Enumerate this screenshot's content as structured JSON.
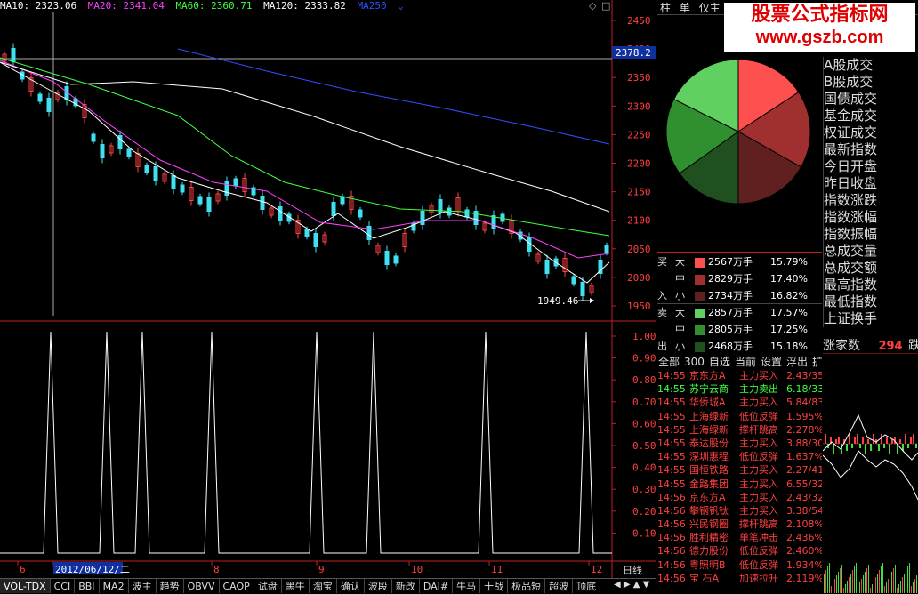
{
  "ma_bar": {
    "ma10": "MA10: 2323.06",
    "ma20": "MA20: 2341.04",
    "ma60": "MA60: 2360.71",
    "ma120": "MA120: 2333.82",
    "ma250": "MA250"
  },
  "colors": {
    "ma10": "#ffffff",
    "ma20": "#ff40ff",
    "ma60": "#40ff40",
    "ma120": "#ffffff",
    "ma250": "#3050ff",
    "up": "#ff4040",
    "down": "#40e0f0",
    "axis": "#c02020",
    "label": "#ff4040"
  },
  "price_axis": {
    "ticks": [
      "2450",
      "2400",
      "2350",
      "2300",
      "2250",
      "2200",
      "2150",
      "2100",
      "2050",
      "2000",
      "1950"
    ],
    "current_price": "2378.2",
    "low_marker": "1949.46"
  },
  "indicator_axis": {
    "ticks": [
      "1.00",
      "0.90",
      "0.80",
      "0.70",
      "0.60",
      "0.50",
      "0.40",
      "0.30",
      "0.20",
      "0.10"
    ]
  },
  "date_axis": {
    "labels": [
      "6",
      "2012/06/12/二",
      "8",
      "9",
      "10",
      "11",
      "12"
    ],
    "period": "日线"
  },
  "bottom_tabs": [
    "VOL-TDX",
    "CCI",
    "BBI",
    "MA2",
    "波主",
    "趋势",
    "OBVV",
    "CAOP",
    "试盘",
    "黑牛",
    "淘宝",
    "确认",
    "波段",
    "新改",
    "DAI#",
    "牛马",
    "十战",
    "极品短",
    "超波",
    "顶底"
  ],
  "right_tabs": [
    "柱",
    "单",
    "仅主"
  ],
  "watermark": {
    "line1": "股票公式指标网",
    "line2": "www.gszb.com"
  },
  "pie": {
    "slices": [
      {
        "value": 15.79,
        "color": "#ff5050"
      },
      {
        "value": 17.4,
        "color": "#a03030"
      },
      {
        "value": 16.82,
        "color": "#602020"
      },
      {
        "value": 15.18,
        "color": "#205020"
      },
      {
        "value": 17.25,
        "color": "#309030"
      },
      {
        "value": 17.57,
        "color": "#60d060"
      }
    ]
  },
  "cj_menu": [
    "A股成交",
    "B股成交",
    "国债成交",
    "基金成交",
    "权证成交",
    "最新指数",
    "今日开盘",
    "昨日收盘",
    "指数涨跌",
    "指数涨幅",
    "指数振幅",
    "总成交量",
    "总成交额",
    "最高指数",
    "最低指数",
    "上证换手"
  ],
  "flow": {
    "buy_label": "买入",
    "sell_label": "卖出",
    "buy": [
      {
        "size": "大",
        "amount": "2567万手",
        "pct": "15.79%",
        "color": "#ff5050"
      },
      {
        "size": "中",
        "amount": "2829万手",
        "pct": "17.40%",
        "color": "#a03030"
      },
      {
        "size": "小",
        "amount": "2734万手",
        "pct": "16.82%",
        "color": "#602020"
      }
    ],
    "sell": [
      {
        "size": "大",
        "amount": "2857万手",
        "pct": "17.57%",
        "color": "#60d060"
      },
      {
        "size": "中",
        "amount": "2805万手",
        "pct": "17.25%",
        "color": "#309030"
      },
      {
        "size": "小",
        "amount": "2468万手",
        "pct": "15.18%",
        "color": "#205020"
      }
    ]
  },
  "rise_count": {
    "label": "涨家数",
    "value": "294",
    "suffix": "跌"
  },
  "tick_tabs": [
    "全部",
    "300",
    "自选",
    "当前",
    "设置",
    "浮出",
    "扩"
  ],
  "ticks": [
    {
      "time": "14:55",
      "name": "京东方A",
      "action": "主力买入",
      "value": "2.43/35",
      "color": "#ff4040"
    },
    {
      "time": "14:55",
      "name": "苏宁云商",
      "action": "主力卖出",
      "value": "6.18/33",
      "color": "#40ff40"
    },
    {
      "time": "14:55",
      "name": "华侨城A",
      "action": "主力买入",
      "value": "5.84/83",
      "color": "#ff4040"
    },
    {
      "time": "14:55",
      "name": "上海绿新",
      "action": "低位反弹",
      "value": "1.595%",
      "color": "#ff4040"
    },
    {
      "time": "14:55",
      "name": "上海绿新",
      "action": "撑杆跳高",
      "value": "2.278%",
      "color": "#ff4040"
    },
    {
      "time": "14:55",
      "name": "泰达股份",
      "action": "主力买入",
      "value": "3.88/30",
      "color": "#ff4040"
    },
    {
      "time": "14:55",
      "name": "深圳惠程",
      "action": "低位反弹",
      "value": "1.637%",
      "color": "#ff4040"
    },
    {
      "time": "14:55",
      "name": "国恒铁路",
      "action": "主力买入",
      "value": "2.27/41",
      "color": "#ff4040"
    },
    {
      "time": "14:55",
      "name": "金路集团",
      "action": "主力买入",
      "value": "6.55/32",
      "color": "#ff4040"
    },
    {
      "time": "14:56",
      "name": "京东方A",
      "action": "主力买入",
      "value": "2.43/32",
      "color": "#ff4040"
    },
    {
      "time": "14:56",
      "name": "攀钢钒钛",
      "action": "主力买入",
      "value": "3.38/54",
      "color": "#ff4040"
    },
    {
      "time": "14:56",
      "name": "兴民钢圈",
      "action": "撑杆跳高",
      "value": "2.108%",
      "color": "#ff4040"
    },
    {
      "time": "14:56",
      "name": "胜利精密",
      "action": "单笔冲击",
      "value": "2.436%",
      "color": "#ff4040"
    },
    {
      "time": "14:56",
      "name": "德力股份",
      "action": "低位反弹",
      "value": "2.460%",
      "color": "#ff4040"
    },
    {
      "time": "14:56",
      "name": "粤照明B",
      "action": "低位反弹",
      "value": "1.934%",
      "color": "#ff4040"
    },
    {
      "time": "14:56",
      "name": "宝 石A",
      "action": "加速拉升",
      "value": "2.119%",
      "color": "#ff4040"
    }
  ]
}
